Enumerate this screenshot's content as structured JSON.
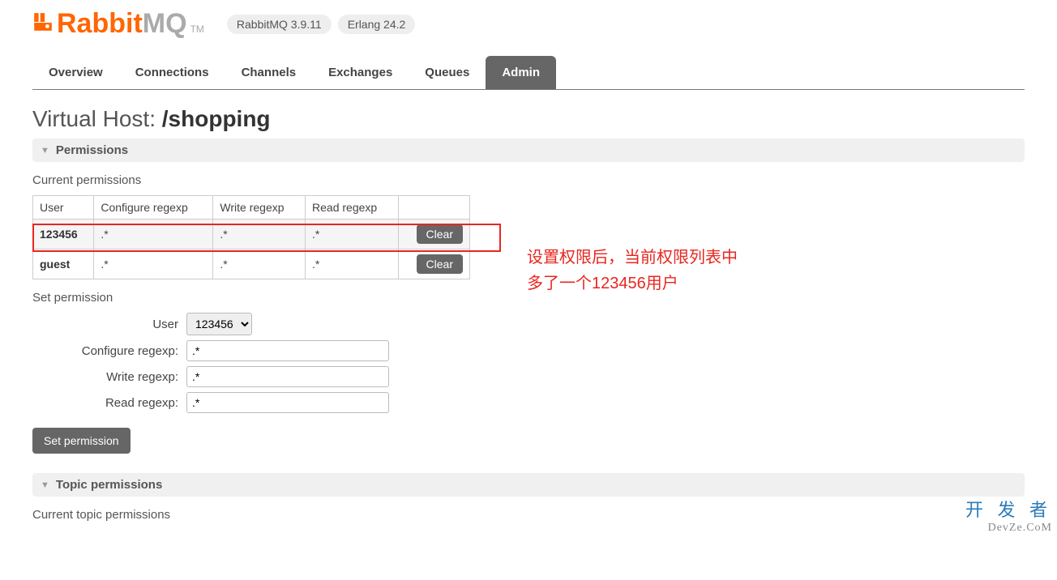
{
  "header": {
    "logo_rabbit": "Rabbit",
    "logo_mq": "MQ",
    "logo_tm": "TM",
    "version_pill": "RabbitMQ 3.9.11",
    "erlang_pill": "Erlang 24.2"
  },
  "nav": {
    "tabs": [
      "Overview",
      "Connections",
      "Channels",
      "Exchanges",
      "Queues",
      "Admin"
    ],
    "active_index": 5
  },
  "title_prefix": "Virtual Host:",
  "title_value": "/shopping",
  "permissions": {
    "section_label": "Permissions",
    "current_label": "Current permissions",
    "columns": [
      "User",
      "Configure regexp",
      "Write regexp",
      "Read regexp",
      ""
    ],
    "rows": [
      {
        "user": "123456",
        "configure": ".*",
        "write": ".*",
        "read": ".*",
        "button": "Clear"
      },
      {
        "user": "guest",
        "configure": ".*",
        "write": ".*",
        "read": ".*",
        "button": "Clear"
      }
    ]
  },
  "set_permission": {
    "heading": "Set permission",
    "user_label": "User",
    "user_value": "123456",
    "configure_label": "Configure regexp:",
    "configure_value": ".*",
    "write_label": "Write regexp:",
    "write_value": ".*",
    "read_label": "Read regexp:",
    "read_value": ".*",
    "button": "Set permission"
  },
  "topic_permissions": {
    "section_label": "Topic permissions",
    "current_label": "Current topic permissions"
  },
  "annotation": {
    "line1": "设置权限后，当前权限列表中",
    "line2": "多了一个123456用户"
  },
  "watermark": {
    "line1": "开 发 者",
    "line2": "DevZe.CoM"
  }
}
